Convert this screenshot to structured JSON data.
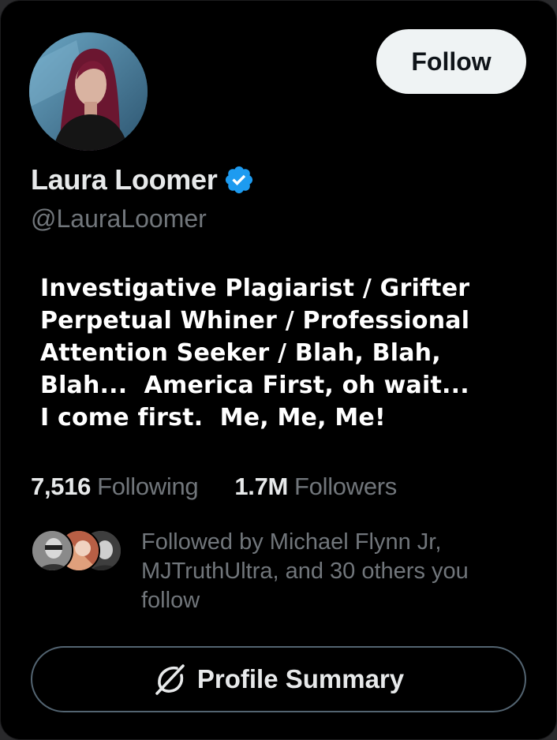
{
  "profile": {
    "display_name": "Laura Loomer",
    "handle": "@LauraLoomer",
    "verified": true,
    "verified_color": "#1d9bf0",
    "bio": "Investigative Plagiarist / Grifter\nPerpetual Whiner / Professional\nAttention Seeker / Blah, Blah,\nBlah...  America First, oh wait...\nI come first.  Me, Me, Me!"
  },
  "actions": {
    "follow_label": "Follow",
    "profile_summary_label": "Profile Summary"
  },
  "stats": {
    "following_count": "7,516",
    "following_label": "Following",
    "followers_count": "1.7M",
    "followers_label": "Followers"
  },
  "followed_by": {
    "text": "Followed by Michael Flynn Jr, MJTruthUltra, and 30 others you follow"
  },
  "icons": {
    "verified": "verified-badge-icon",
    "summary": "grok-slash-icon"
  }
}
